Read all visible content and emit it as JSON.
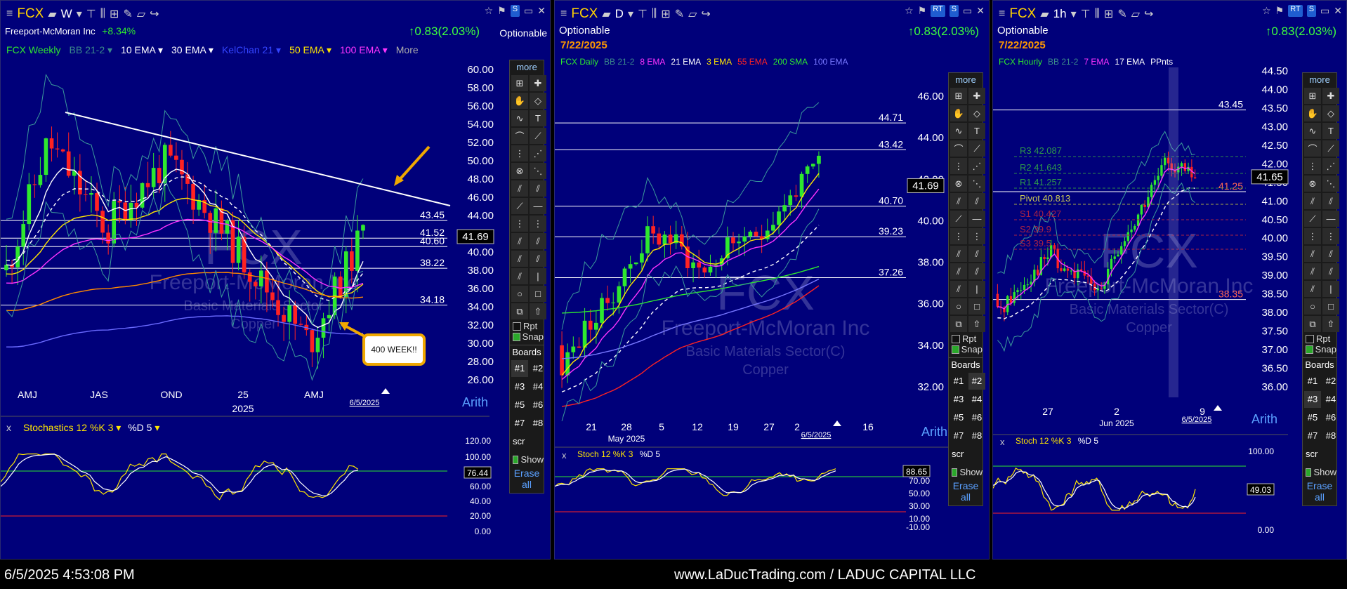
{
  "panels": [
    {
      "symbol": "FCX",
      "interval": "W",
      "company": "Freeport-McMoran Inc",
      "pct_change": "+8.34%",
      "change": "↑0.83(2.03%)",
      "tag": "Optionable",
      "indicators": [
        {
          "label": "FCX Weekly",
          "color": "#2ee82e"
        },
        {
          "label": "BB 21-2",
          "color": "#3b8a8a"
        },
        {
          "label": "10 EMA",
          "color": "#ffffff"
        },
        {
          "label": "30 EMA",
          "color": "#ffffff"
        },
        {
          "label": "KelChan 21",
          "color": "#3344ff"
        },
        {
          "label": "50 EMA",
          "color": "#ffe600"
        },
        {
          "label": "100 EMA",
          "color": "#ff33ff"
        },
        {
          "label": "More",
          "color": "#aaaaaa"
        }
      ],
      "y_ticks": [
        "60.00",
        "58.00",
        "56.00",
        "54.00",
        "52.00",
        "50.00",
        "48.00",
        "46.00",
        "44.00",
        "42.00",
        "40.00",
        "38.00",
        "36.00",
        "34.00",
        "32.00",
        "30.00",
        "28.00",
        "26.00"
      ],
      "levels": [
        "43.45",
        "41.52",
        "40.60",
        "38.22",
        "34.18"
      ],
      "price": "41.69",
      "x_labels": [
        "AMJ",
        "JAS",
        "OND",
        "25",
        "AMJ"
      ],
      "x_year": "2025",
      "date_marker": "6/5/2025",
      "callout": "400 WEEK!!",
      "stoch_label": "Stochastics 12 %K 3",
      "stoch_d": "%D 5",
      "stoch_ticks": [
        "120.00",
        "100.00",
        "80.00",
        "60.00",
        "40.00",
        "20.00",
        "0.00"
      ],
      "stoch_value": "76.44",
      "arith": "Arith",
      "watermark": {
        "sym": "FCX",
        "name": "Freeport-McMoran Inc",
        "sector": "Basic Materials Sector",
        "industry": "Copper"
      }
    },
    {
      "symbol": "FCX",
      "interval": "D",
      "tag": "Optionable",
      "date": "7/22/2025",
      "change": "↑0.83(2.03%)",
      "indicators": [
        {
          "label": "FCX Daily",
          "color": "#2ee82e"
        },
        {
          "label": "BB 21-2",
          "color": "#3b8a8a"
        },
        {
          "label": "8 EMA",
          "color": "#ff33ff"
        },
        {
          "label": "21 EMA",
          "color": "#ffffff"
        },
        {
          "label": "3 EMA",
          "color": "#ffe600"
        },
        {
          "label": "55 EMA",
          "color": "#ff2222"
        },
        {
          "label": "200 SMA",
          "color": "#2ee82e"
        },
        {
          "label": "100 EMA",
          "color": "#7777ff"
        }
      ],
      "y_ticks": [
        "46.00",
        "44.00",
        "42.00",
        "40.00",
        "38.00",
        "36.00",
        "34.00",
        "32.00"
      ],
      "levels": [
        "44.71",
        "43.42",
        "40.70",
        "39.23",
        "37.26"
      ],
      "price": "41.69",
      "x_labels": [
        "21",
        "28",
        "5",
        "12",
        "19",
        "27",
        "2",
        "16"
      ],
      "x_month": "May 2025",
      "date_marker": "6/5/2025",
      "stoch_label": "Stoch 12 %K 3",
      "stoch_d": "%D 5",
      "stoch_ticks": [
        "70.00",
        "50.00",
        "30.00",
        "10.00",
        "-10.00"
      ],
      "stoch_value": "88.65",
      "arith": "Arith",
      "watermark": {
        "sym": "FCX",
        "name": "Freeport-McMoran Inc",
        "sector": "Basic Materials Sector(C)",
        "industry": "Copper"
      }
    },
    {
      "symbol": "FCX",
      "interval": "1h",
      "tag": "Optionable",
      "date": "7/22/2025",
      "change": "↑0.83(2.03%)",
      "indicators": [
        {
          "label": "FCX Hourly",
          "color": "#2ee82e"
        },
        {
          "label": "BB 21-2",
          "color": "#3b8a8a"
        },
        {
          "label": "7 EMA",
          "color": "#ff33ff"
        },
        {
          "label": "17 EMA",
          "color": "#ffffff"
        },
        {
          "label": "PPnts",
          "color": "#ffffff"
        }
      ],
      "y_ticks": [
        "44.50",
        "44.00",
        "43.50",
        "43.00",
        "42.50",
        "42.00",
        "41.50",
        "41.00",
        "40.50",
        "40.00",
        "39.50",
        "39.00",
        "38.50",
        "38.00",
        "37.50",
        "37.00",
        "36.50",
        "36.00"
      ],
      "levels": [
        "43.45",
        "41.25",
        "38.35"
      ],
      "pivots": [
        "R3 42.087",
        "R2 41.643",
        "R1 41.257",
        "Pivot 40.813",
        "S1 40.427",
        "S2 39.9",
        "S3 39.5"
      ],
      "price": "41.65",
      "x_labels": [
        "27",
        "2",
        "9"
      ],
      "x_month": "Jun 2025",
      "date_marker": "6/5/2025",
      "stoch_label": "Stoch 12 %K 3",
      "stoch_d": "%D 5",
      "stoch_ticks": [
        "100.00",
        "0.00"
      ],
      "stoch_value": "49.03",
      "arith": "Arith",
      "watermark": {
        "sym": "FCX",
        "name": "Freeport-McMoran Inc",
        "sector": "Basic Materials Sector(C)",
        "industry": "Copper"
      }
    }
  ],
  "toolbar": {
    "more": "more",
    "rpt": "Rpt",
    "snap": "Snap",
    "boards_title": "Boards",
    "boards": [
      "#1",
      "#2",
      "#3",
      "#4",
      "#5",
      "#6",
      "#7",
      "#8"
    ],
    "scr": "scr",
    "show": "Show",
    "erase_all": "Erase all"
  },
  "footer": {
    "datetime": "6/5/2025 4:53:08 PM",
    "site": "www.LaDucTrading.com / LADUC CAPITAL LLC"
  },
  "colors": {
    "panel_bg": "#00007a",
    "up": "#2ee82e",
    "down": "#ff2222",
    "symbol": "#ffd200",
    "orange": "#f0a800"
  }
}
